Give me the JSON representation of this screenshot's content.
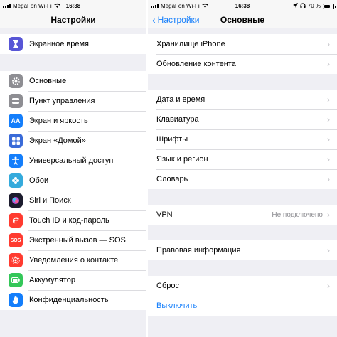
{
  "status": {
    "carrier": "MegaFon Wi-Fi",
    "time": "16:38",
    "battery": "70 %",
    "battery_level": 0.7
  },
  "left": {
    "title": "Настройки",
    "group1": [
      {
        "label": "Экранное время",
        "icon": "hourglass-icon",
        "color": "#5856d6"
      }
    ],
    "group2": [
      {
        "label": "Основные",
        "icon": "gear-icon",
        "color": "#8e8e93"
      },
      {
        "label": "Пункт управления",
        "icon": "control-center-icon",
        "color": "#8e8e93"
      },
      {
        "label": "Экран и яркость",
        "icon": "display-brightness-icon",
        "color": "#147efb"
      },
      {
        "label": "Экран «Домой»",
        "icon": "home-grid-icon",
        "color": "#3a6bd8"
      },
      {
        "label": "Универсальный доступ",
        "icon": "accessibility-icon",
        "color": "#147efb"
      },
      {
        "label": "Обои",
        "icon": "wallpaper-flower-icon",
        "color": "#34aadc"
      },
      {
        "label": "Siri и Поиск",
        "icon": "siri-icon",
        "color": "#1c1c2e"
      },
      {
        "label": "Touch ID и код-пароль",
        "icon": "fingerprint-icon",
        "color": "#ff3b30"
      },
      {
        "label": "Экстренный вызов — SOS",
        "icon": "sos-icon",
        "color": "#ff3b30",
        "text": "SOS"
      },
      {
        "label": "Уведомления о контакте",
        "icon": "exposure-notification-icon",
        "color": "#ff3b30"
      },
      {
        "label": "Аккумулятор",
        "icon": "battery-icon",
        "color": "#34c759"
      },
      {
        "label": "Конфиденциальность",
        "icon": "privacy-hand-icon",
        "color": "#147efb"
      }
    ]
  },
  "right": {
    "back_label": "Настройки",
    "title": "Основные",
    "group1": [
      {
        "label": "Хранилище iPhone"
      },
      {
        "label": "Обновление контента"
      }
    ],
    "group2": [
      {
        "label": "Дата и время"
      },
      {
        "label": "Клавиатура"
      },
      {
        "label": "Шрифты"
      },
      {
        "label": "Язык и регион"
      },
      {
        "label": "Словарь"
      }
    ],
    "group3": [
      {
        "label": "VPN",
        "value": "Не подключено"
      }
    ],
    "group4": [
      {
        "label": "Правовая информация"
      }
    ],
    "group5": [
      {
        "label": "Сброс"
      },
      {
        "label": "Выключить"
      }
    ]
  }
}
